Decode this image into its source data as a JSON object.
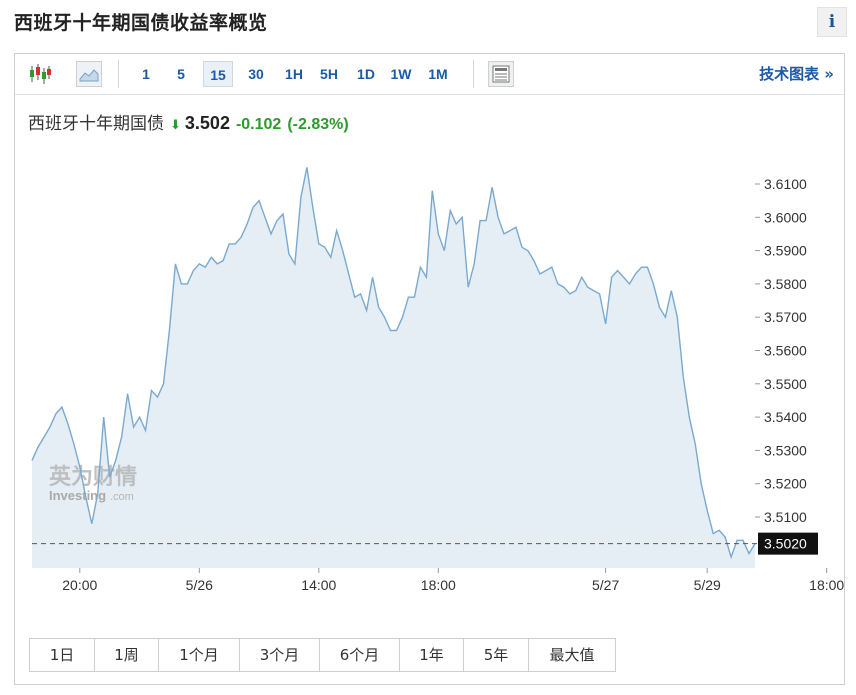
{
  "page": {
    "title": "西班牙十年期国债收益率概览",
    "info_label": "i"
  },
  "toolbar": {
    "timeframes": [
      "1",
      "5",
      "15",
      "30",
      "1H",
      "5H",
      "1D",
      "1W",
      "1M"
    ],
    "active_timeframe": "15",
    "tech_chart_label": "技术图表 »"
  },
  "quote": {
    "name": "西班牙十年期国债",
    "price": "3.502",
    "change": "-0.102",
    "change_pct": "(-2.83%)",
    "direction": "down"
  },
  "watermark": {
    "cn": "英为财情",
    "en": "Investing",
    "en_suffix": ".com"
  },
  "ranges": [
    "1日",
    "1周",
    "1个月",
    "3个月",
    "6个月",
    "1年",
    "5年",
    "最大值"
  ],
  "colors": {
    "line": "#7aa9cf",
    "area": "#e5eef5",
    "up": "#2c9b2c",
    "link": "#1b5aa6"
  },
  "chart_data": {
    "type": "area",
    "title": "",
    "xlabel": "",
    "ylabel": "",
    "ylim": [
      3.496,
      3.62
    ],
    "y_ticks": [
      "3.6100",
      "3.6000",
      "3.5900",
      "3.5800",
      "3.5700",
      "3.5600",
      "3.5500",
      "3.5400",
      "3.5300",
      "3.5200",
      "3.5100"
    ],
    "x_ticks": [
      {
        "label": "20:00",
        "i": 8
      },
      {
        "label": "5/26",
        "i": 28
      },
      {
        "label": "14:00",
        "i": 48
      },
      {
        "label": "18:00",
        "i": 68
      },
      {
        "label": "5/27",
        "i": 96
      },
      {
        "label": "5/29",
        "i": 113
      },
      {
        "label": "18:00",
        "i": 133
      }
    ],
    "last_value_label": "3.5020",
    "last_value": 3.502,
    "grid": false,
    "values": [
      3.527,
      3.531,
      3.534,
      3.537,
      3.541,
      3.543,
      3.538,
      3.532,
      3.525,
      3.516,
      3.508,
      3.517,
      3.54,
      3.522,
      3.527,
      3.534,
      3.547,
      3.537,
      3.54,
      3.536,
      3.548,
      3.546,
      3.55,
      3.566,
      3.586,
      3.58,
      3.58,
      3.584,
      3.586,
      3.585,
      3.588,
      3.586,
      3.587,
      3.592,
      3.592,
      3.594,
      3.598,
      3.603,
      3.605,
      3.6,
      3.595,
      3.599,
      3.601,
      3.589,
      3.586,
      3.606,
      3.615,
      3.603,
      3.592,
      3.591,
      3.588,
      3.596,
      3.59,
      3.583,
      3.576,
      3.577,
      3.572,
      3.582,
      3.573,
      3.57,
      3.566,
      3.566,
      3.57,
      3.576,
      3.576,
      3.585,
      3.582,
      3.608,
      3.595,
      3.59,
      3.602,
      3.598,
      3.6,
      3.579,
      3.586,
      3.599,
      3.599,
      3.609,
      3.6,
      3.595,
      3.596,
      3.597,
      3.591,
      3.59,
      3.587,
      3.583,
      3.584,
      3.585,
      3.58,
      3.579,
      3.577,
      3.578,
      3.582,
      3.579,
      3.578,
      3.577,
      3.568,
      3.582,
      3.584,
      3.582,
      3.58,
      3.583,
      3.585,
      3.585,
      3.58,
      3.573,
      3.57,
      3.578,
      3.57,
      3.552,
      3.54,
      3.532,
      3.52,
      3.512,
      3.505,
      3.506,
      3.504,
      3.498,
      3.503,
      3.503,
      3.499,
      3.502
    ]
  }
}
